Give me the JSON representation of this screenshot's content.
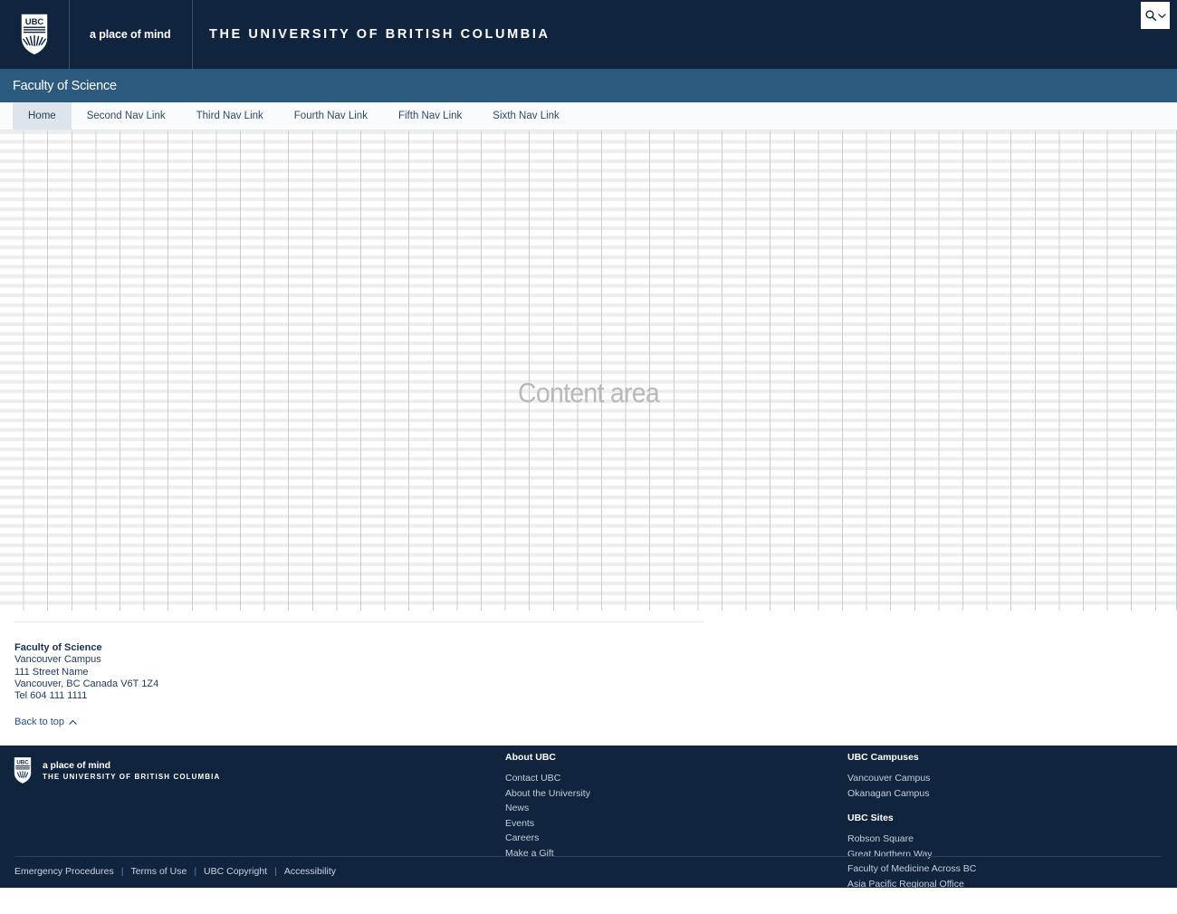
{
  "header": {
    "crest_label": "UBC",
    "tagline": "a place of mind",
    "university_name": "THE UNIVERSITY OF BRITISH COLUMBIA",
    "search_icon": "search-icon",
    "search_chevron_icon": "chevron-down-icon"
  },
  "unit_bar": {
    "title": "Faculty of Science"
  },
  "nav": {
    "items": [
      {
        "label": "Home",
        "active": true
      },
      {
        "label": "Second Nav Link",
        "active": false
      },
      {
        "label": "Third Nav Link",
        "active": false
      },
      {
        "label": "Fourth Nav Link",
        "active": false
      },
      {
        "label": "Fifth Nav Link",
        "active": false
      },
      {
        "label": "Sixth Nav Link",
        "active": false
      }
    ]
  },
  "content": {
    "placeholder_label": "Content area"
  },
  "contact": {
    "name": "Faculty of Science",
    "campus": "Vancouver Campus",
    "street": "111 Street Name",
    "city_line": "Vancouver, BC Canada V6T 1Z4",
    "tel": "Tel 604 111 1111",
    "back_to_top": "Back to top",
    "back_to_top_icon": "chevron-up-icon"
  },
  "footer": {
    "logo_tagline": "a place of mind",
    "logo_university": "THE UNIVERSITY OF BRITISH COLUMBIA",
    "columns": [
      {
        "heading": "About UBC",
        "links": [
          "Contact UBC",
          "About the University",
          "News",
          "Events",
          "Careers",
          "Make a Gift"
        ]
      },
      {
        "heading": "UBC Campuses",
        "links": [
          "Vancouver Campus",
          "Okanagan Campus"
        ],
        "heading2": "UBC Sites",
        "links2": [
          "Robson Square",
          "Great Northern Way",
          "Faculty of Medicine Across BC",
          "Asia Pacific Regional Office"
        ]
      }
    ],
    "legal_links": [
      "Emergency Procedures",
      "Terms of Use",
      "UBC Copyright",
      "Accessibility"
    ],
    "legal_separator": "|"
  },
  "colors": {
    "navy": "#10243e",
    "steel_blue": "#2b5a7e",
    "active_tab": "#dde4ec",
    "link_blue": "#1d4e8f",
    "grid_line": "#c9cdd2"
  }
}
